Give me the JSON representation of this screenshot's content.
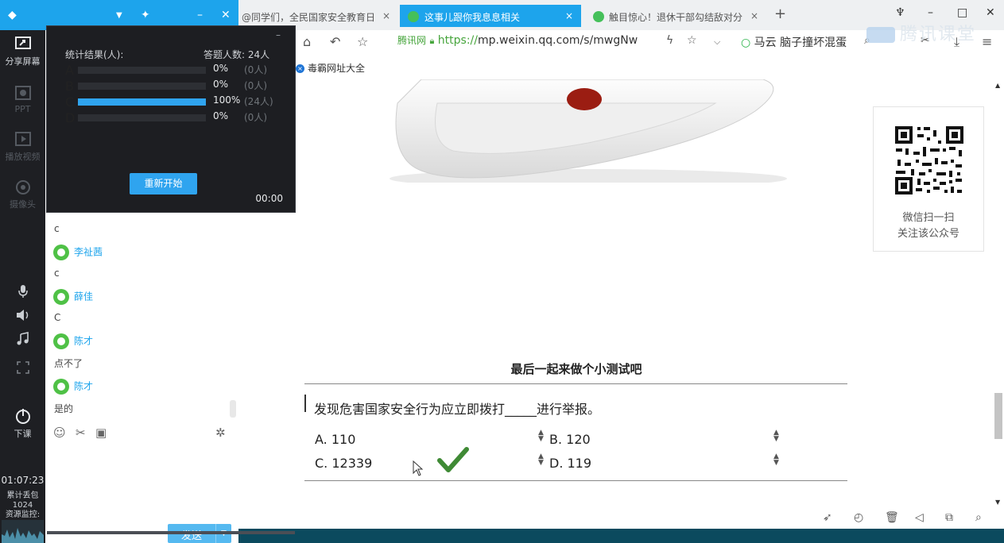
{
  "left_toolbar": {
    "share_screen": "分享屏幕",
    "ppt": "PPT",
    "play_video": "播放视频",
    "camera": "摄像头",
    "end_class": "下课",
    "elapsed": "01:07:23",
    "packet_loss_label": "累计丢包",
    "packet_loss_value": "1024",
    "resource_monitor": "资源监控:"
  },
  "quiz_popup": {
    "minimize": "–",
    "title": "统计结果(人):",
    "respondents": "答题人数: 24人",
    "rows": [
      {
        "option": "A",
        "percent": "0%",
        "count": "(0人)",
        "ratio": 0
      },
      {
        "option": "B",
        "percent": "0%",
        "count": "(0人)",
        "ratio": 0
      },
      {
        "option": "C",
        "percent": "100%",
        "count": "(24人)",
        "ratio": 1
      },
      {
        "option": "D",
        "percent": "0%",
        "count": "(0人)",
        "ratio": 0
      }
    ],
    "restart": "重新开始",
    "timer": "00:00"
  },
  "chat": {
    "messages": [
      {
        "text": "c"
      },
      {
        "name": "李祉茜",
        "text": "c"
      },
      {
        "name": "薛佳",
        "text": "C"
      },
      {
        "name": "陈才",
        "text": "点不了"
      },
      {
        "name": "陈才",
        "text": "是的"
      }
    ],
    "send": "发送"
  },
  "browser": {
    "tabs": [
      {
        "title": "@同学们，全民国家安全教育日",
        "close": "×"
      },
      {
        "title": "这事儿跟你我息息相关",
        "close": "×"
      },
      {
        "title": "触目惊心！退休干部勾结敌对分",
        "close": "×"
      }
    ],
    "address": {
      "site": "腾讯网",
      "https": "https://",
      "rest": "mp.weixin.qq.com/s/mwgNw"
    },
    "search_text": "马云 脑子撞坏混蛋",
    "bookmark": "毒霸网址大全",
    "watermark": "腾讯课堂"
  },
  "page": {
    "qr_caption_1": "微信扫一扫",
    "qr_caption_2": "关注该公众号",
    "quiz_title": "最后一起来做个小测试吧",
    "question": "发现危害国家安全行为应立即拨打_____进行举报。",
    "options": [
      {
        "label": "A. 110"
      },
      {
        "label": "B. 120"
      },
      {
        "label": "C. 12339"
      },
      {
        "label": "D. 119"
      }
    ]
  },
  "colors": {
    "accent": "#1da4ec",
    "bar_fill": "#2fa4ef",
    "check": "#3f8a35",
    "footer": "#0b4a5e"
  }
}
